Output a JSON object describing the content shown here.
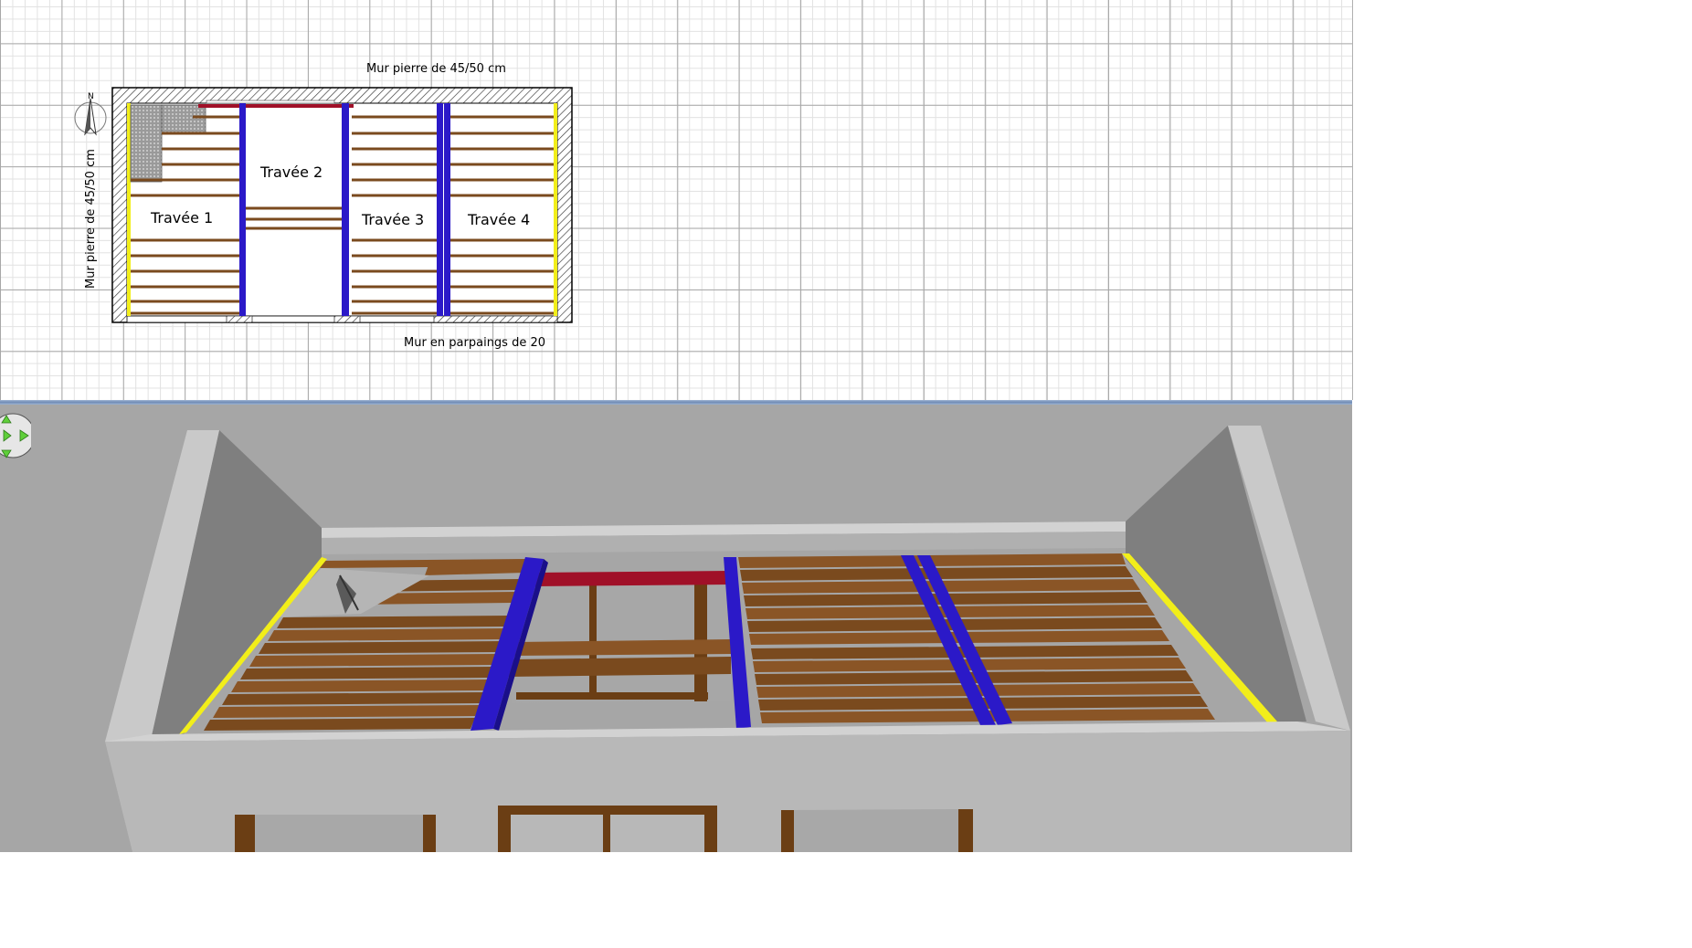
{
  "plan": {
    "wall_top_label": "Mur pierre de 45/50 cm",
    "wall_left_label": "Mur pierre de 45/50 cm",
    "wall_bottom_label": "Mur en parpaings de 20",
    "bays": [
      "Travée 1",
      "Travée 2",
      "Travée 3",
      "Travée 4"
    ],
    "compass_letter": "N"
  },
  "colors": {
    "beam_blue": "#2b19c8",
    "joist_brown": "#7a4a1e",
    "ledger_yellow": "#f2ee1a",
    "trimmer_red": "#a01028",
    "wall_gray": "#c8c8c8"
  },
  "icons": {
    "compass": "compass-icon",
    "navigation": "navigation-arrows-icon"
  }
}
